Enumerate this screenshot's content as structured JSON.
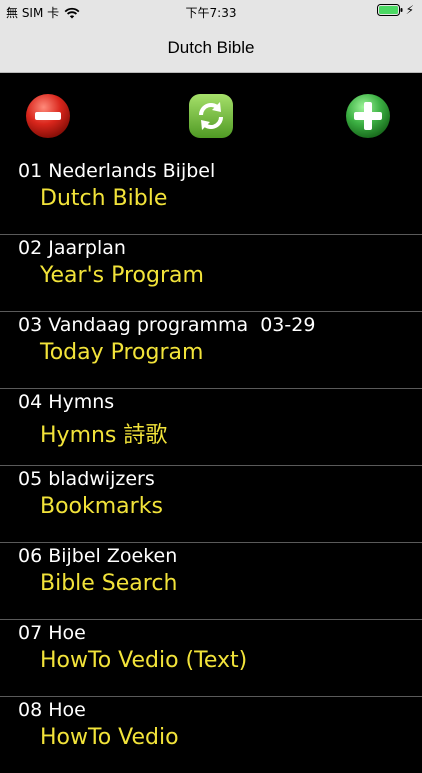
{
  "status_bar": {
    "carrier": "無 SIM 卡",
    "time": "下午7:33",
    "wifi_icon": "wifi-icon",
    "battery_icon": "battery-icon",
    "battery_color": "#4cd964"
  },
  "nav": {
    "title": "Dutch Bible"
  },
  "toolbar": {
    "remove_icon": "minus-circle-icon",
    "refresh_icon": "refresh-icon",
    "add_icon": "plus-circle-icon",
    "colors": {
      "remove": "#d9261c",
      "refresh": "#6fbf3a",
      "add": "#3cb043"
    }
  },
  "list": {
    "items": [
      {
        "title": "01 Nederlands Bijbel",
        "subtitle": "Dutch Bible"
      },
      {
        "title": "02 Jaarplan",
        "subtitle": "Year's Program"
      },
      {
        "title": "03 Vandaag programma  03-29",
        "subtitle": "Today Program"
      },
      {
        "title": "04 Hymns",
        "subtitle": "Hymns 詩歌"
      },
      {
        "title": "05 bladwijzers",
        "subtitle": "Bookmarks"
      },
      {
        "title": "06 Bijbel Zoeken",
        "subtitle": "Bible Search"
      },
      {
        "title": "07 Hoe",
        "subtitle": "HowTo Vedio (Text)"
      },
      {
        "title": "08 Hoe",
        "subtitle": "HowTo Vedio"
      }
    ],
    "title_color": "#ffffff",
    "subtitle_color": "#f2e33a"
  }
}
